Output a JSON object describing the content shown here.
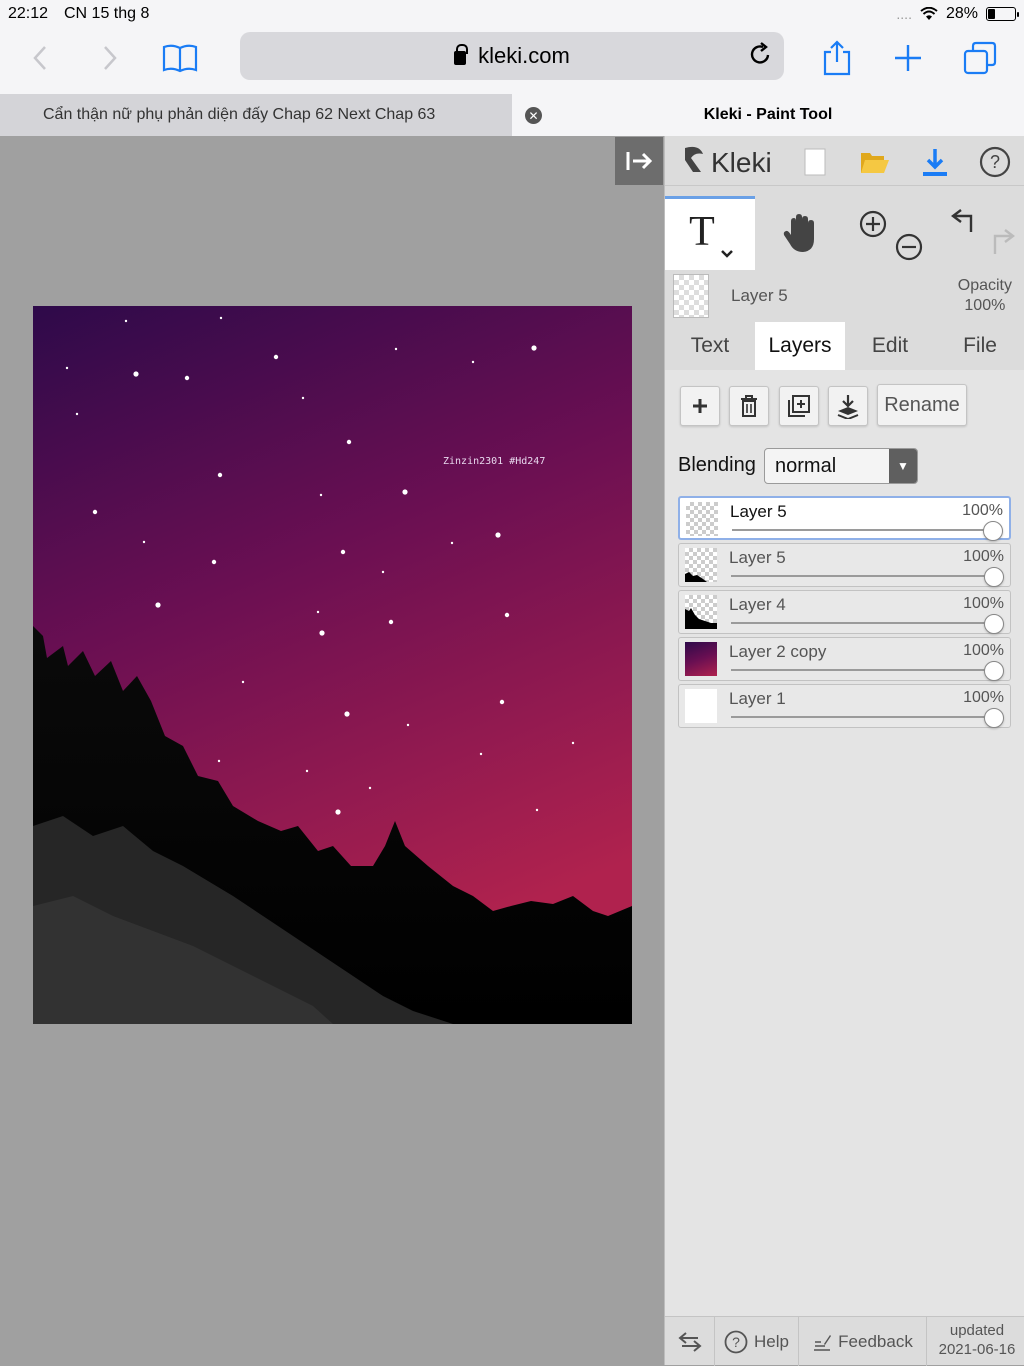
{
  "status_bar": {
    "time": "22:12",
    "date": "CN 15 thg 8",
    "signal": "....",
    "battery_text": "28%",
    "battery_level": 0.28
  },
  "browser": {
    "url": "kleki.com",
    "tabs": [
      {
        "title": "Cẩn thận nữ phụ phản diện đấy Chap 62 Next Chap 63",
        "active": false
      },
      {
        "title": "Kleki - Paint Tool",
        "active": true
      }
    ],
    "accent_color": "#1a7cf5"
  },
  "canvas": {
    "watermark": "Zinzin2301 #Hd247",
    "sky_top_color": "#3a0a55",
    "sky_bottom_color": "#a01a4e"
  },
  "app": {
    "logo_text": "Kleki",
    "header_icons": [
      "new-image-icon",
      "open-folder-icon",
      "download-icon",
      "help-icon"
    ],
    "tools": [
      "text-tool-icon",
      "hand-tool-icon",
      "zoom-in-icon",
      "zoom-out-icon",
      "undo-icon",
      "redo-icon"
    ],
    "current_layer": {
      "name": "Layer 5",
      "opacity_label": "Opacity",
      "opacity_value": "100%"
    },
    "tabs": [
      "Text",
      "Layers",
      "Edit",
      "File"
    ],
    "active_tab": "Layers",
    "layer_actions": {
      "rename_label": "Rename"
    },
    "blending": {
      "label": "Blending",
      "value": "normal"
    },
    "layers": [
      {
        "name": "Layer 5",
        "opacity": "100%",
        "selected": true
      },
      {
        "name": "Layer 5",
        "opacity": "100%",
        "selected": false
      },
      {
        "name": "Layer 4",
        "opacity": "100%",
        "selected": false
      },
      {
        "name": "Layer 2 copy",
        "opacity": "100%",
        "selected": false
      },
      {
        "name": "Layer 1",
        "opacity": "100%",
        "selected": false
      }
    ],
    "footer": {
      "help_label": "Help",
      "feedback_label": "Feedback",
      "updated_label": "updated",
      "updated_date": "2021-06-16"
    }
  }
}
